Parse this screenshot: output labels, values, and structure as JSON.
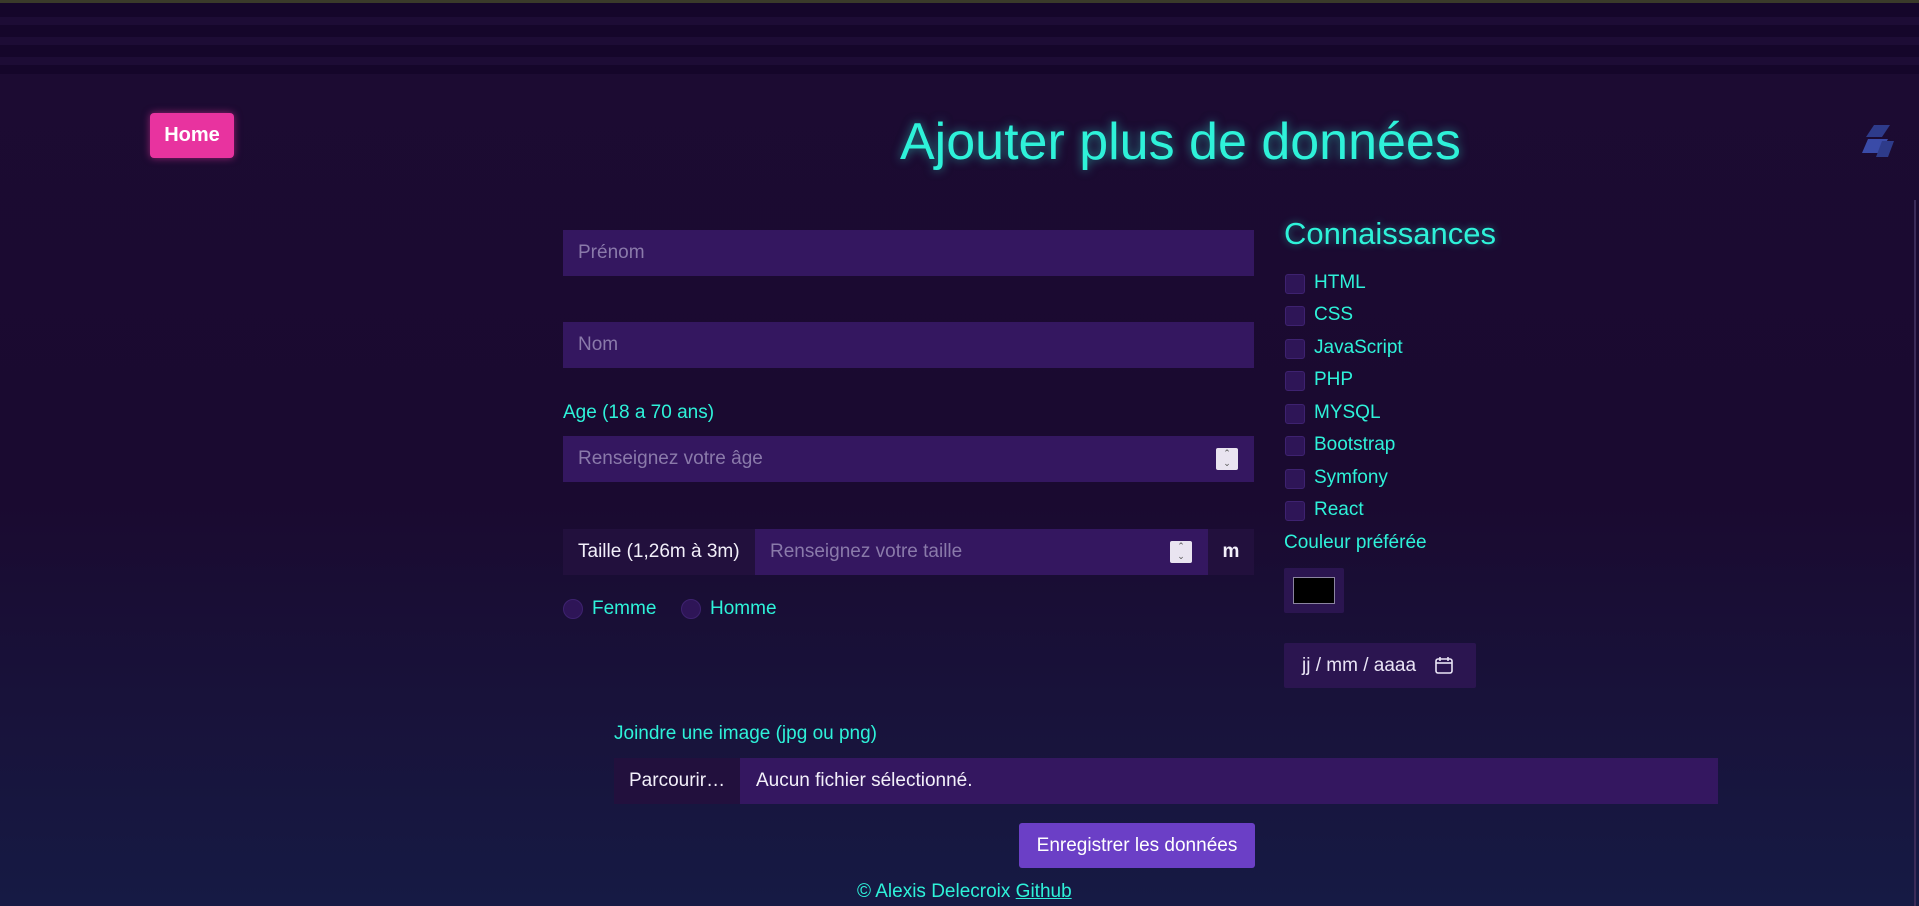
{
  "nav": {
    "home_label": "Home"
  },
  "page": {
    "title": "Ajouter plus de données"
  },
  "form": {
    "prenom_placeholder": "Prénom",
    "nom_placeholder": "Nom",
    "age_label": "Age (18 a 70 ans)",
    "age_placeholder": "Renseignez votre âge",
    "taille_label": "Taille (1,26m à 3m)",
    "taille_placeholder": "Renseignez votre taille",
    "taille_unit": "m",
    "gender": [
      {
        "label": "Femme"
      },
      {
        "label": "Homme"
      }
    ],
    "file_label": "Joindre une image (jpg ou png)",
    "file_browse_label": "Parcourir…",
    "file_status": "Aucun fichier sélectionné.",
    "submit_label": "Enregistrer les données"
  },
  "skills": {
    "title": "Connaissances",
    "items": [
      {
        "label": "HTML"
      },
      {
        "label": "CSS"
      },
      {
        "label": "JavaScript"
      },
      {
        "label": "PHP"
      },
      {
        "label": "MYSQL"
      },
      {
        "label": "Bootstrap"
      },
      {
        "label": "Symfony"
      },
      {
        "label": "React"
      }
    ],
    "color_label": "Couleur préférée",
    "color_value": "#000000",
    "date_placeholder": "jj / mm / aaaa"
  },
  "footer": {
    "copyright": "© Alexis Delecroix",
    "link_label": "Github"
  },
  "theme": {
    "accent": "#2ef2d9",
    "home_button": "#e8339f",
    "submit_button": "#6b3fc6",
    "input_bg": "#341760"
  }
}
